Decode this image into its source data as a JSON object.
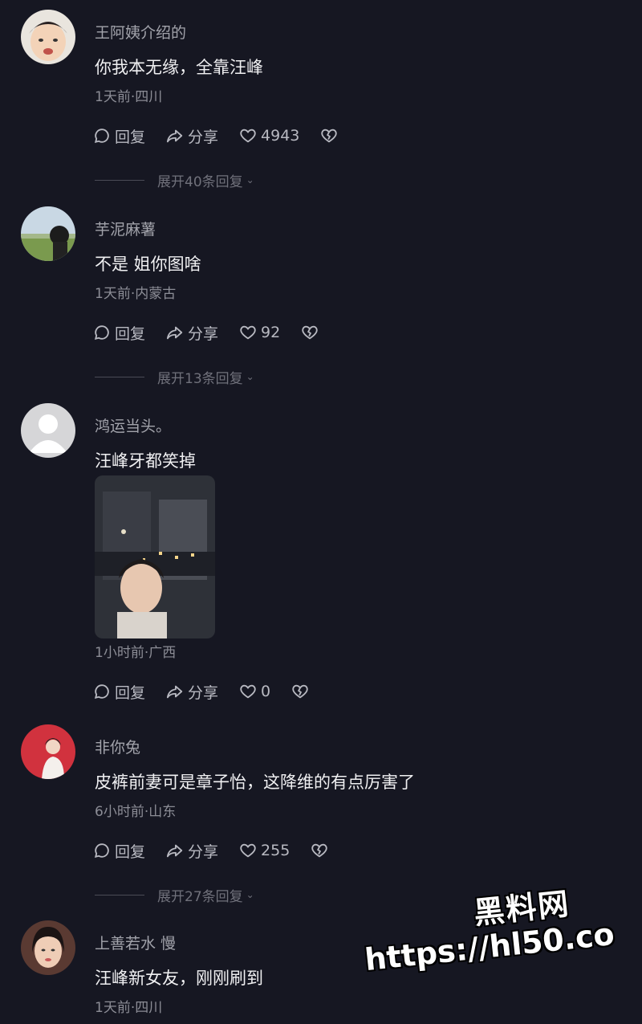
{
  "comments": [
    {
      "username": "王阿姨介绍的",
      "text": "你我本无缘，全靠汪峰",
      "meta": "1天前·四川",
      "reply_label": "回复",
      "share_label": "分享",
      "likes": "4943",
      "expand_label": "展开40条回复"
    },
    {
      "username": "芋泥麻薯",
      "text": "不是 姐你图啥",
      "meta": "1天前·内蒙古",
      "reply_label": "回复",
      "share_label": "分享",
      "likes": "92",
      "expand_label": "展开13条回复"
    },
    {
      "username": "鸿运当头。",
      "text": "汪峰牙都笑掉",
      "meta": "1小时前·广西",
      "reply_label": "回复",
      "share_label": "分享",
      "likes": "0"
    },
    {
      "username": "非你兔",
      "text": "皮裤前妻可是章子怡，这降维的有点厉害了",
      "meta": "6小时前·山东",
      "reply_label": "回复",
      "share_label": "分享",
      "likes": "255",
      "expand_label": "展开27条回复"
    },
    {
      "username": "上善若水 慢",
      "text": "汪峰新女友，刚刚刷到",
      "meta": "1天前·四川"
    }
  ],
  "watermark": {
    "line1": "黑料网",
    "line2": "https://hl50.co"
  },
  "icons": {
    "reply": "comment-bubble-icon",
    "share": "share-arrow-icon",
    "like": "heart-icon",
    "dislike": "broken-heart-icon",
    "expand": "chevron-down-icon"
  },
  "colors": {
    "background": "#161722",
    "text_primary": "#f0f0f2",
    "text_secondary": "#a2a3ab"
  }
}
